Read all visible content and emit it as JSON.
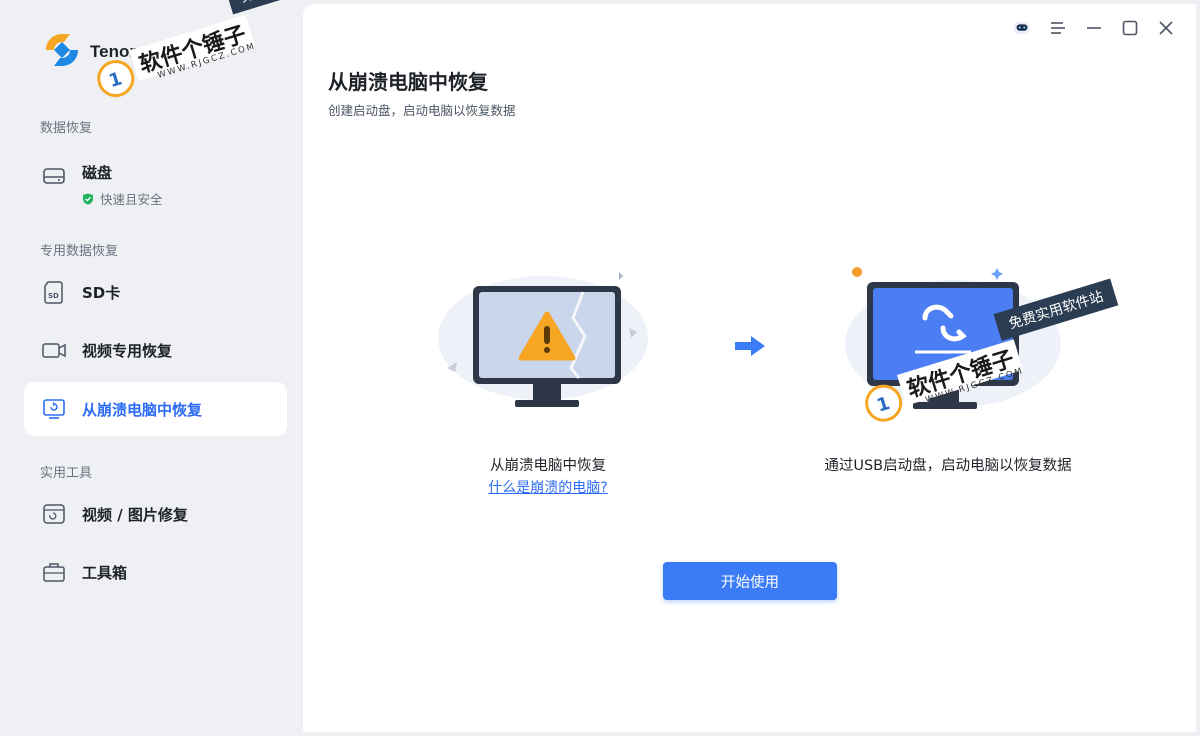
{
  "app": {
    "name": "Tenorshare"
  },
  "sidebar": {
    "sections": [
      {
        "title": "数据恢复"
      },
      {
        "title": "专用数据恢复"
      },
      {
        "title": "实用工具"
      }
    ],
    "items": [
      {
        "label": "磁盘",
        "status": "快速且安全",
        "icon": "hard-drive-icon"
      },
      {
        "label": "SD卡",
        "icon": "sd-card-icon"
      },
      {
        "label": "视频专用恢复",
        "icon": "video-camera-icon"
      },
      {
        "label": "从崩溃电脑中恢复",
        "icon": "crashed-computer-icon",
        "active": true
      },
      {
        "label": "视频 / 图片修复",
        "icon": "media-repair-icon"
      },
      {
        "label": "工具箱",
        "icon": "toolbox-icon"
      }
    ]
  },
  "main": {
    "title": "从崩溃电脑中恢复",
    "subtitle": "创建启动盘，启动电脑以恢复数据",
    "left_caption": "从崩溃电脑中恢复",
    "left_link": "什么是崩溃的电脑?",
    "right_caption": "通过USB启动盘，启动电脑以恢复数据",
    "start_button": "开始使用"
  },
  "watermark": {
    "band": "免费实用软件站",
    "main": "软件个锤子",
    "url": "WWW.RJGCZ.COM"
  },
  "colors": {
    "accent": "#2c6cf5",
    "button": "#3b7bf6",
    "sidebar_bg": "#eef0f4",
    "success": "#22b35e"
  }
}
